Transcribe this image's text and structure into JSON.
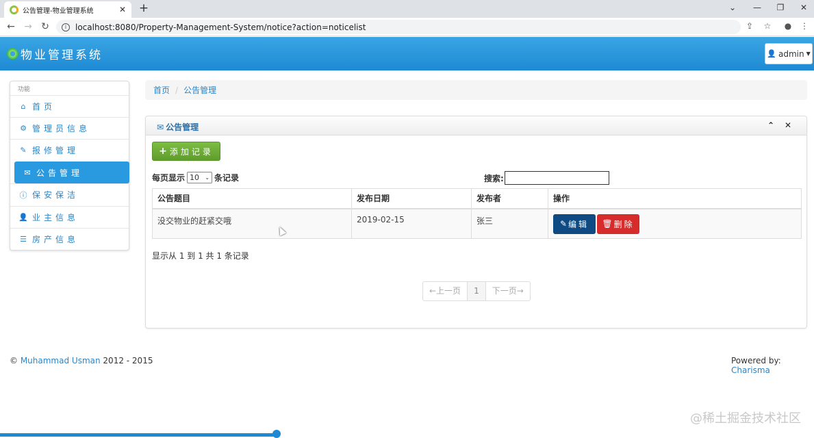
{
  "browser": {
    "tab_title": "公告管理-物业管理系统",
    "tab_close": "✕",
    "new_tab": "+",
    "url": "localhost:8080/Property-Management-System/notice?action=noticelist",
    "win_controls": [
      "⌄",
      "—",
      "❐",
      "✕"
    ]
  },
  "header": {
    "brand": "物业管理系统",
    "user": "admin"
  },
  "sidebar": {
    "heading": "功能",
    "items": [
      {
        "label": "首页",
        "icon": "home-icon",
        "glyph": "⌂"
      },
      {
        "label": "管理员信息",
        "icon": "gear-icon",
        "glyph": "⚙"
      },
      {
        "label": "报修管理",
        "icon": "wrench-icon",
        "glyph": "✎"
      },
      {
        "label": "公告管理",
        "icon": "envelope-icon",
        "glyph": "✉"
      },
      {
        "label": "保安保洁",
        "icon": "info-icon",
        "glyph": "ⓘ"
      },
      {
        "label": "业主信息",
        "icon": "user-icon",
        "glyph": "👤"
      },
      {
        "label": "房产信息",
        "icon": "list-icon",
        "glyph": "☰"
      }
    ]
  },
  "breadcrumb": {
    "home": "首页",
    "current": "公告管理"
  },
  "panel": {
    "title": "公告管理",
    "add_label": "添加记录",
    "per_page_prefix": "每页显示",
    "per_page_value": "10",
    "per_page_suffix": "条记录",
    "search_label": "搜索:",
    "columns": [
      "公告题目",
      "发布日期",
      "发布者",
      "操作"
    ],
    "rows": [
      {
        "title": "没交物业的赶紧交哦",
        "date": "2019-02-15",
        "author": "张三"
      }
    ],
    "edit_label": "编辑",
    "delete_label": "删除",
    "summary": "显示从 1 到 1 共 1 条记录",
    "pager": {
      "prev": "←上一页",
      "page": "1",
      "next": "下一页→"
    }
  },
  "footer": {
    "left_prefix": "©",
    "left_link": "Muhammad Usman",
    "left_years": "2012 - 2015",
    "right_prefix": "Powered by:",
    "right_link": "Charisma"
  },
  "watermark": "@稀土掘金技术社区"
}
